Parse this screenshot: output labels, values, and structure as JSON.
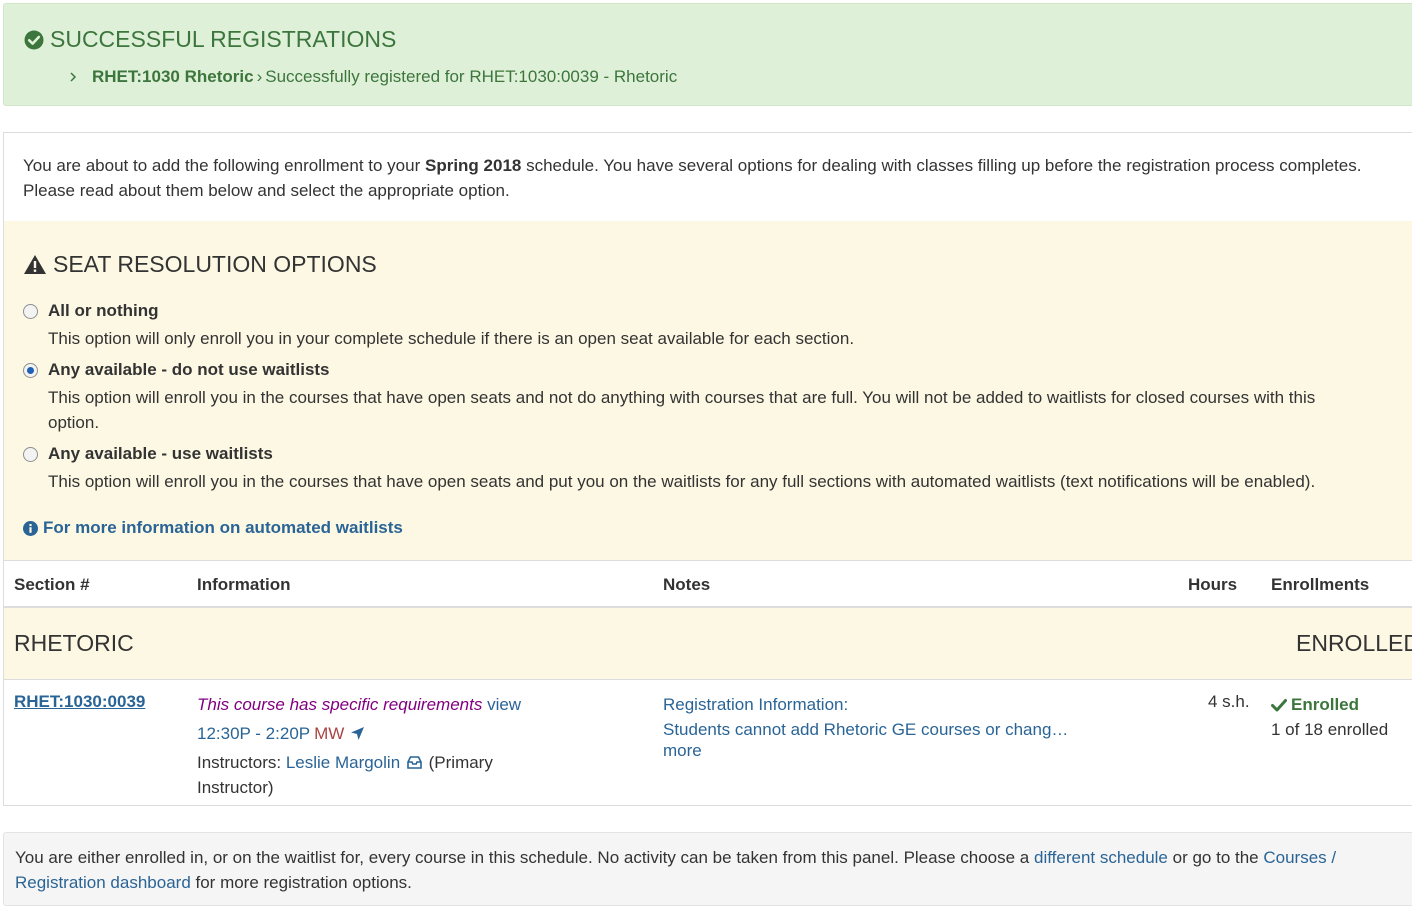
{
  "success": {
    "title": "SUCCESSFUL REGISTRATIONS",
    "course": "RHET:1030 Rhetoric",
    "message": "Successfully registered for RHET:1030:0039 - Rhetoric"
  },
  "intro": {
    "text_before": "You are about to add the following enrollment to your ",
    "term": "Spring 2018",
    "text_after": " schedule. You have several options for dealing with classes filling up before the registration process completes. Please read about them below and select the appropriate option."
  },
  "seat_resolution": {
    "title": "SEAT RESOLUTION OPTIONS",
    "options": [
      {
        "label": "All or nothing",
        "description": "This option will only enroll you in your complete schedule if there is an open seat available for each section.",
        "selected": false
      },
      {
        "label": "Any available - do not use waitlists",
        "description": "This option will enroll you in the courses that have open seats and not do anything with courses that are full. You will not be added to waitlists for closed courses with this option.",
        "selected": true
      },
      {
        "label": "Any available - use waitlists",
        "description": "This option will enroll you in the courses that have open seats and put you on the waitlists for any full sections with automated waitlists (text notifications will be enabled).",
        "selected": false
      }
    ],
    "info_link": "For more information on automated waitlists"
  },
  "table": {
    "headers": {
      "section": "Section #",
      "information": "Information",
      "notes": "Notes",
      "hours": "Hours",
      "enrollments": "Enrollments"
    },
    "group": {
      "name": "RHETORIC",
      "status": "ENROLLED"
    },
    "row": {
      "section": "RHET:1030:0039",
      "requirements": "This course has specific requirements",
      "view_link": "view",
      "time": "12:30P - 2:20P",
      "days": "MW",
      "instructors_label": "Instructors: ",
      "instructor_name": "Leslie Margolin",
      "instructor_role": "(Primary Instructor)",
      "notes_title": "Registration Information:",
      "notes_text": "Students cannot add Rhetoric GE courses or chang…",
      "more_link": "more",
      "hours": "4 s.h.",
      "enrollment_status": "Enrolled",
      "enrollment_count": "1 of 18 enrolled"
    }
  },
  "footer": {
    "text_before": "You are either enrolled in, or on the waitlist for, every course in this schedule. No activity can be taken from this panel. Please choose a ",
    "link1": "different schedule",
    "text_middle": " or go to the ",
    "link2": "Courses / Registration dashboard",
    "text_after": " for more registration options."
  },
  "colors": {
    "success_bg": "#dff0d8",
    "success_text": "#3c763d",
    "warning_bg": "#fcf8e3",
    "link": "#2a6496",
    "requirements": "#800080",
    "days": "#a94442",
    "footer_bg": "#f5f5f5"
  },
  "icons": {
    "success": "check-circle-icon",
    "warning": "warning-triangle-icon",
    "info": "info-circle-icon",
    "breadcrumb": "chevron-right-icon",
    "location": "location-arrow-icon",
    "email": "inbox-icon",
    "enrolled": "check-icon"
  }
}
